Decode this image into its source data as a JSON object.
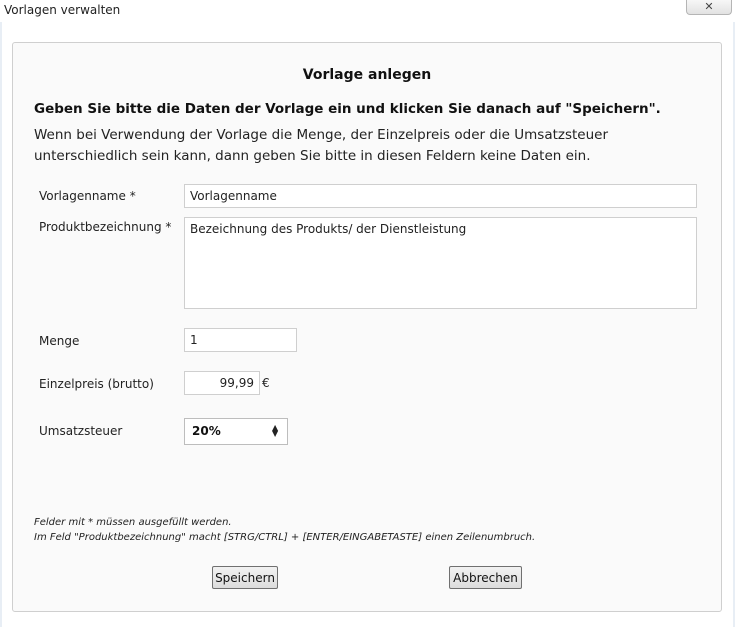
{
  "window": {
    "title": "Vorlagen verwalten",
    "close_label": "✕"
  },
  "form": {
    "heading": "Vorlage anlegen",
    "intro_bold": "Geben Sie bitte die Daten der Vorlage ein und klicken Sie danach auf \"Speichern\".",
    "intro_text": "Wenn bei Verwendung der Vorlage die Menge, der Einzelpreis oder die Umsatzsteuer unterschiedlich sein kann, dann geben Sie bitte in diesen Feldern keine Daten ein.",
    "template_name": {
      "label": "Vorlagenname *",
      "value": "Vorlagenname"
    },
    "product_description": {
      "label": "Produktbezeichnung *",
      "value": "Bezeichnung des Produkts/ der Dienstleistung"
    },
    "quantity": {
      "label": "Menge",
      "value": "1"
    },
    "unit_price": {
      "label": "Einzelpreis (brutto)",
      "value": "99,99",
      "currency": "€"
    },
    "vat": {
      "label": "Umsatzsteuer",
      "selected": "20%"
    },
    "hint_required": "Felder mit * müssen ausgefüllt werden.",
    "hint_linebreak": "Im Feld \"Produktbezeichnung\" macht [STRG/CTRL] + [ENTER/EINGABETASTE] einen Zeilenumbruch.",
    "save_label": "Speichern",
    "cancel_label": "Abbrechen"
  }
}
